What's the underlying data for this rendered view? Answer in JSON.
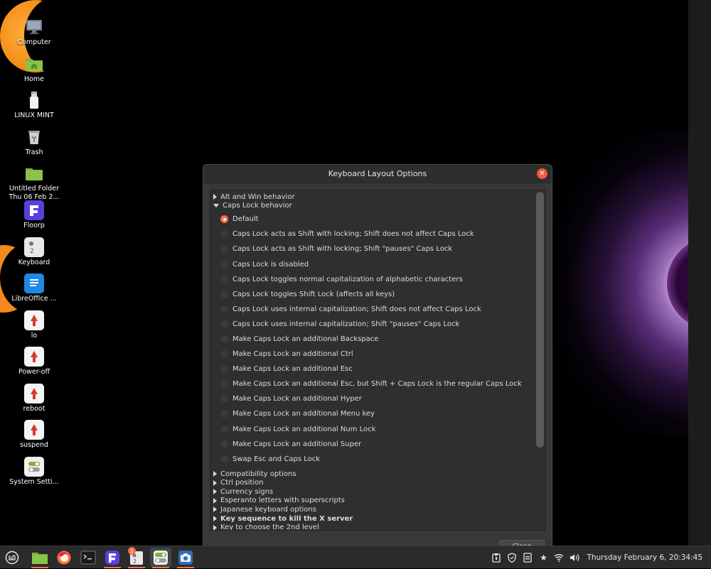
{
  "desktop": {
    "icons": [
      {
        "label": "Computer",
        "icon": "computer-icon"
      },
      {
        "label": "Home",
        "icon": "home-folder-icon"
      },
      {
        "label": "LINUX MINT",
        "icon": "usb-drive-icon"
      },
      {
        "label": "Trash",
        "icon": "trash-icon"
      },
      {
        "label": "Untitled Folder",
        "sublabel": "Thu 06 Feb 2...",
        "icon": "folder-icon"
      },
      {
        "label": "Floorp",
        "icon": "floorp-icon"
      },
      {
        "label": "Keyboard",
        "icon": "keyboard-doc-icon"
      },
      {
        "label": "LibreOffice ...",
        "icon": "libreoffice-icon"
      },
      {
        "label": "lo",
        "icon": "script-icon"
      },
      {
        "label": "Power-off",
        "icon": "script-icon"
      },
      {
        "label": "reboot",
        "icon": "script-icon"
      },
      {
        "label": "suspend",
        "icon": "script-icon"
      },
      {
        "label": "System Setti...",
        "icon": "settings-toggle-icon"
      }
    ]
  },
  "dialog": {
    "title": "Keyboard Layout Options",
    "close_label": "Close",
    "top_groups": [
      {
        "label": "Alt and Win behavior",
        "expanded": false
      }
    ],
    "expanded_group": {
      "label": "Caps Lock behavior",
      "options": [
        {
          "label": "Default",
          "selected": true
        },
        {
          "label": "Caps Lock acts as Shift with locking; Shift does not affect Caps Lock",
          "selected": false
        },
        {
          "label": "Caps Lock acts as Shift with locking; Shift \"pauses\" Caps Lock",
          "selected": false
        },
        {
          "label": "Caps Lock is disabled",
          "selected": false
        },
        {
          "label": "Caps Lock toggles normal capitalization of alphabetic characters",
          "selected": false
        },
        {
          "label": "Caps Lock toggles Shift Lock (affects all keys)",
          "selected": false
        },
        {
          "label": "Caps Lock uses internal capitalization; Shift does not affect Caps Lock",
          "selected": false
        },
        {
          "label": "Caps Lock uses internal capitalization; Shift \"pauses\" Caps Lock",
          "selected": false
        },
        {
          "label": "Make Caps Lock an additional Backspace",
          "selected": false
        },
        {
          "label": "Make Caps Lock an additional Ctrl",
          "selected": false
        },
        {
          "label": "Make Caps Lock an additional Esc",
          "selected": false
        },
        {
          "label": "Make Caps Lock an additional Esc, but Shift + Caps Lock is the regular Caps Lock",
          "selected": false
        },
        {
          "label": "Make Caps Lock an additional Hyper",
          "selected": false
        },
        {
          "label": "Make Caps Lock an additional Menu key",
          "selected": false
        },
        {
          "label": "Make Caps Lock an additional Num Lock",
          "selected": false
        },
        {
          "label": "Make Caps Lock an additional Super",
          "selected": false
        },
        {
          "label": "Swap Esc and Caps Lock",
          "selected": false
        }
      ]
    },
    "bottom_groups": [
      {
        "label": "Compatibility options",
        "bold": false
      },
      {
        "label": "Ctrl position",
        "bold": false
      },
      {
        "label": "Currency signs",
        "bold": false
      },
      {
        "label": "Esperanto letters with superscripts",
        "bold": false
      },
      {
        "label": "Japanese keyboard options",
        "bold": false
      },
      {
        "label": "Key sequence to kill the X server",
        "bold": true
      },
      {
        "label": "Key to choose the 2nd level",
        "bold": false
      }
    ]
  },
  "taskbar": {
    "items": [
      {
        "name": "menu-button",
        "icon": "mint-menu-icon"
      },
      {
        "name": "files",
        "icon": "folder-icon"
      },
      {
        "name": "firefox",
        "icon": "firefox-icon"
      },
      {
        "name": "terminal",
        "icon": "terminal-icon"
      },
      {
        "name": "floorp",
        "icon": "floorp-icon"
      },
      {
        "name": "keyboard-doc",
        "icon": "keyboard-doc-icon",
        "badge": "2"
      },
      {
        "name": "system-settings",
        "icon": "settings-toggle-icon",
        "active": true
      },
      {
        "name": "screenshot",
        "icon": "camera-icon"
      }
    ],
    "clock": "Thursday February 6, 20:34:45",
    "colors": {
      "accent": "#f36c4b",
      "panel": "#2b2b2b"
    }
  }
}
